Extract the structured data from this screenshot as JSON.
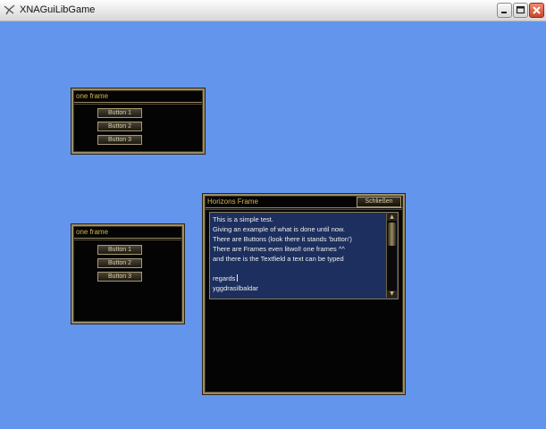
{
  "window": {
    "title": "XNAGuiLibGame",
    "icon": "xna-app-icon",
    "controls": [
      "minimize-icon",
      "maximize-icon",
      "close-icon"
    ]
  },
  "frames": [
    {
      "title": "one frame",
      "buttons": [
        "Button 1",
        "Button 2",
        "Button 3"
      ]
    },
    {
      "title": "one frame",
      "buttons": [
        "Button 1",
        "Button 2",
        "Button 3"
      ]
    }
  ],
  "horizons": {
    "title": "Horizons Frame",
    "close_label": "Schließen",
    "text_lines": [
      "This is a simple test.",
      "Giving an example of what is done until now.",
      "There are Buttons (look there it stands 'button')",
      "There are Frames even litwol! one frames ^^",
      "and there is the Textfield a text can be typed",
      "",
      "regards",
      "yggdrasilbaldar"
    ]
  },
  "colors": {
    "background": "#6395ec",
    "frame_border": "#9b8d6a",
    "title_text": "#d8b64a",
    "textbox_bg": "#1c2f5e"
  }
}
